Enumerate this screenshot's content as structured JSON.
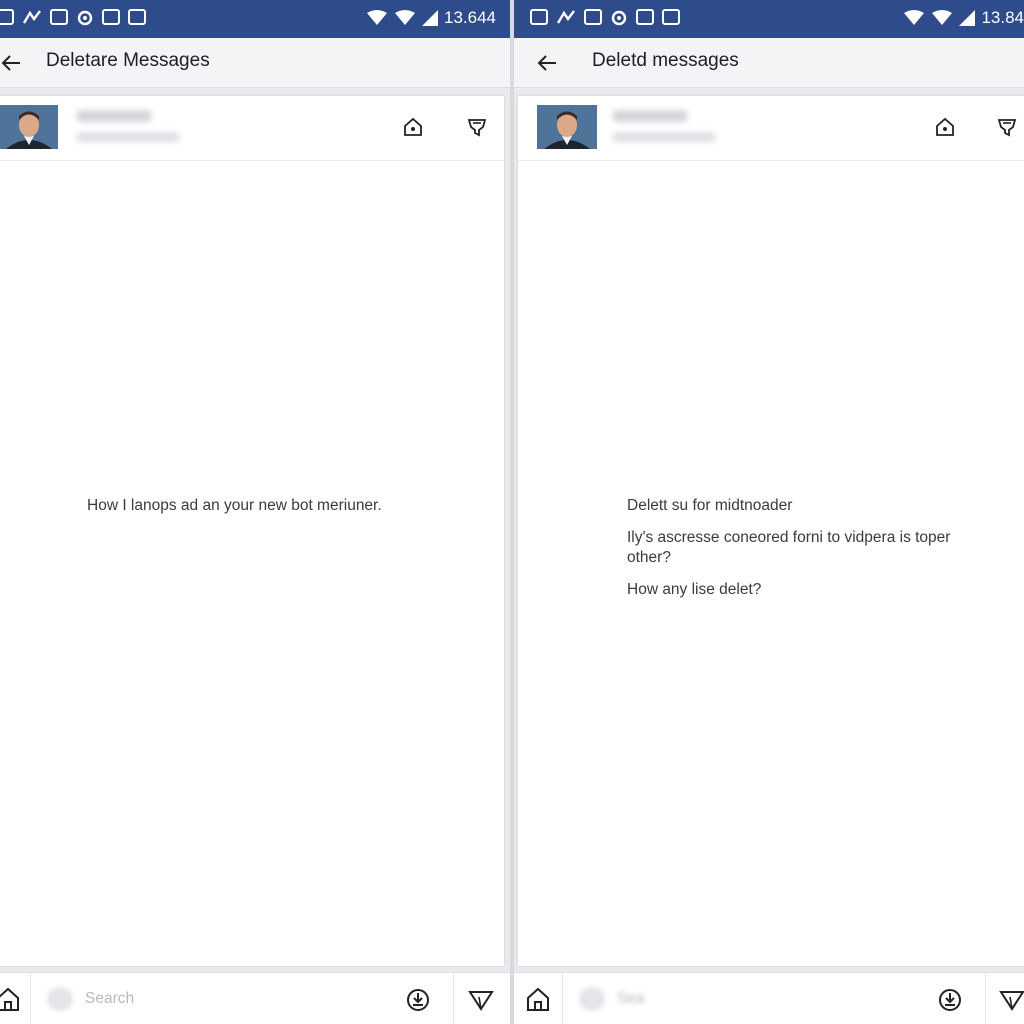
{
  "left": {
    "status_time": "13.644",
    "app_title": "Deletare Messages",
    "messages": [
      "How I lanops ad an your new bot meriuner."
    ],
    "search_placeholder": "Search"
  },
  "right": {
    "status_time": "13.84",
    "app_title": "Deletd messages",
    "messages": [
      "Delett su for midtnoader",
      "Ily's ascresse coneored forni to vidpera is toper other?",
      "How any lise delet?"
    ],
    "search_placeholder": "Sea"
  },
  "icons": {
    "back": "arrow-left-icon",
    "home_outline": "home-icon",
    "filter": "filter-icon",
    "download": "download-icon",
    "send": "send-icon"
  },
  "colors": {
    "status_bar": "#2e4b8c",
    "app_bar": "#f4f4f6",
    "card": "#ffffff",
    "text": "#1e1f24"
  }
}
